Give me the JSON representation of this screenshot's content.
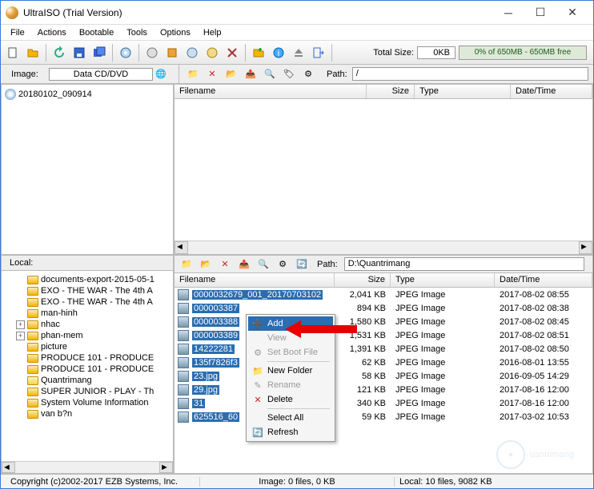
{
  "title": "UltraISO (Trial Version)",
  "menu": [
    "File",
    "Actions",
    "Bootable",
    "Tools",
    "Options",
    "Help"
  ],
  "totalsize": {
    "label": "Total Size:",
    "value": "0KB"
  },
  "progress": "0% of 650MB - 650MB free",
  "image": {
    "label": "Image:",
    "type": "Data CD/DVD",
    "root": "20180102_090914"
  },
  "top_path_label": "Path:",
  "top_path_value": "/",
  "cols": {
    "filename": "Filename",
    "size": "Size",
    "type": "Type",
    "date": "Date/Time"
  },
  "local_label": "Local:",
  "bot_path_label": "Path:",
  "bot_path_value": "D:\\Quantrimang",
  "local_tree": [
    {
      "indent": 1,
      "exp": "",
      "name": "documents-export-2015-05-1"
    },
    {
      "indent": 1,
      "exp": "",
      "name": "EXO - THE WAR - The 4th A"
    },
    {
      "indent": 1,
      "exp": "",
      "name": "EXO - THE WAR - The 4th A"
    },
    {
      "indent": 1,
      "exp": "",
      "name": "man-hinh"
    },
    {
      "indent": 1,
      "exp": "+",
      "name": "nhac"
    },
    {
      "indent": 1,
      "exp": "+",
      "name": "phan-mem"
    },
    {
      "indent": 1,
      "exp": "",
      "name": "picture"
    },
    {
      "indent": 1,
      "exp": "",
      "name": "PRODUCE 101 - PRODUCE"
    },
    {
      "indent": 1,
      "exp": "",
      "name": "PRODUCE 101 - PRODUCE"
    },
    {
      "indent": 1,
      "exp": "",
      "name": "Quantrimang",
      "open": true
    },
    {
      "indent": 1,
      "exp": "",
      "name": "SUPER JUNIOR - PLAY - Th"
    },
    {
      "indent": 1,
      "exp": "",
      "name": "System Volume Information"
    },
    {
      "indent": 1,
      "exp": "",
      "name": "van b?n"
    }
  ],
  "files": [
    {
      "name": "0000032679_001_20170703102",
      "size": "2,041 KB",
      "type": "JPEG Image",
      "date": "2017-08-02 08:55"
    },
    {
      "name": "000003387",
      "size": "894 KB",
      "type": "JPEG Image",
      "date": "2017-08-02 08:38"
    },
    {
      "name": "000003388",
      "size": "1,580 KB",
      "type": "JPEG Image",
      "date": "2017-08-02 08:45"
    },
    {
      "name": "000003389",
      "size": "1,531 KB",
      "type": "JPEG Image",
      "date": "2017-08-02 08:51"
    },
    {
      "name": "14222281",
      "size": "1,391 KB",
      "type": "JPEG Image",
      "date": "2017-08-02 08:50"
    },
    {
      "name": "135f7826f3",
      "size": "62 KB",
      "type": "JPEG Image",
      "date": "2016-08-01 13:55"
    },
    {
      "name": "23.jpg",
      "size": "58 KB",
      "type": "JPEG Image",
      "date": "2016-09-05 14:29"
    },
    {
      "name": "29.jpg",
      "size": "121 KB",
      "type": "JPEG Image",
      "date": "2017-08-16 12:00"
    },
    {
      "name": "31",
      "size": "340 KB",
      "type": "JPEG Image",
      "date": "2017-08-16 12:00"
    },
    {
      "name": "625516_60",
      "size": "59 KB",
      "type": "JPEG Image",
      "date": "2017-03-02 10:53"
    }
  ],
  "ctx": {
    "add": "Add",
    "view": "View",
    "setboot": "Set Boot File",
    "newfolder": "New Folder",
    "rename": "Rename",
    "delete": "Delete",
    "selectall": "Select All",
    "refresh": "Refresh"
  },
  "status": {
    "copyright": "Copyright (c)2002-2017 EZB Systems, Inc.",
    "center": "Image: 0 files, 0 KB",
    "right": "Local: 10 files, 9082 KB"
  }
}
